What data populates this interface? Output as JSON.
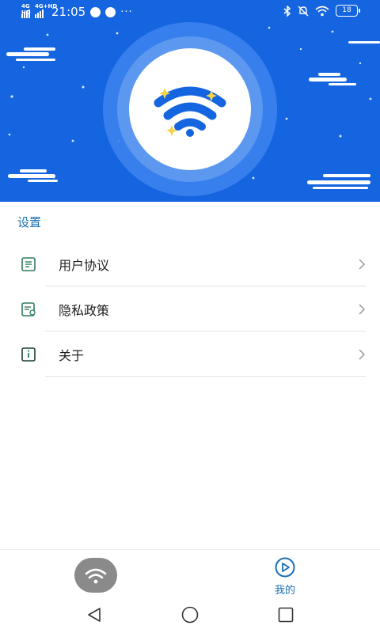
{
  "status_bar": {
    "network_1": "4G HD",
    "network_2": "4G+HD",
    "time": "21:05",
    "more": "···",
    "battery": "18"
  },
  "header": {
    "icon": "wifi-icon",
    "colors": {
      "background": "#1565e0",
      "ring": "#4a8df0",
      "ring_inner": "#6fa6f3",
      "accent": "#1565e0",
      "sparkle": "#f5d34a"
    }
  },
  "settings": {
    "title": "设置",
    "items": [
      {
        "label": "用户协议",
        "icon": "document-icon"
      },
      {
        "label": "隐私政策",
        "icon": "privacy-document-icon"
      },
      {
        "label": "关于",
        "icon": "info-icon"
      }
    ]
  },
  "tabbar": {
    "wifi_icon": "wifi-icon",
    "mine_label": "我的",
    "mine_icon": "play-circle-icon",
    "active_color": "#1a6fb3"
  },
  "system_nav": {
    "back": "back-triangle-icon",
    "home": "home-circle-icon",
    "recents": "recents-square-icon"
  }
}
